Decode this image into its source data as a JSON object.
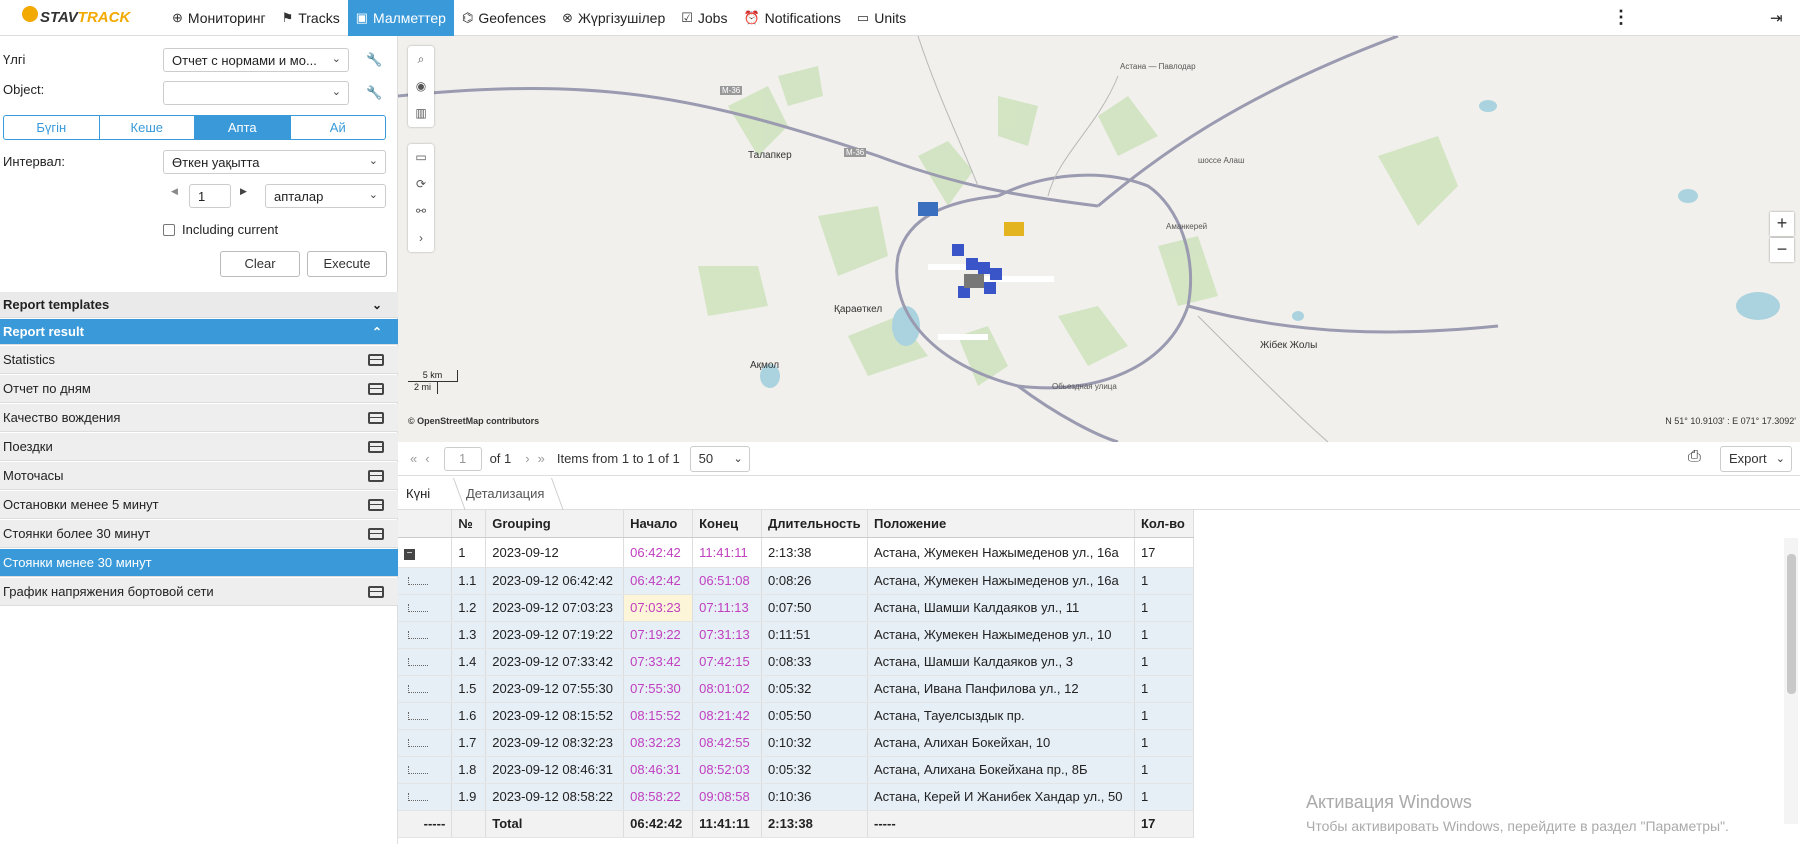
{
  "topbar": {
    "logo_left": "STAV",
    "logo_right": "TRACK",
    "nav": [
      {
        "label": "Мониторинг",
        "icon": "globe-icon"
      },
      {
        "label": "Tracks",
        "icon": "map-icon"
      },
      {
        "label": "Малметтер",
        "icon": "chart-icon",
        "active": true
      },
      {
        "label": "Geofences",
        "icon": "route-icon"
      },
      {
        "label": "Жүргізушілер",
        "icon": "steering-wheel-icon"
      },
      {
        "label": "Jobs",
        "icon": "clipboard-icon"
      },
      {
        "label": "Notifications",
        "icon": "alarm-icon"
      },
      {
        "label": "Units",
        "icon": "bus-icon"
      }
    ]
  },
  "form": {
    "template_label": "Үлгі",
    "template_value": "Отчет с нормами и мо...",
    "object_label": "Object:",
    "object_value": "",
    "periods": [
      "Бүгін",
      "Кеше",
      "Апта",
      "Ай"
    ],
    "active_period": "Апта",
    "interval_label": "Интервал:",
    "interval_value": "Өткен уақытта",
    "count_value": "1",
    "unit_value": "апталар",
    "including_current": "Including current",
    "clear": "Clear",
    "execute": "Execute"
  },
  "sections": {
    "templates": "Report templates",
    "result": "Report result"
  },
  "result_items": [
    "Statistics",
    "Отчет по дням",
    "Качество вождения",
    "Поездки",
    "Моточасы",
    "Остановки менее 5 минут",
    "Стоянки более 30 минут",
    "Стоянки менее 30 минут",
    "График напряжения бортовой сети"
  ],
  "selected_result": "Стоянки менее 30 минут",
  "map": {
    "labels": [
      "Талапкер",
      "Қараөткел",
      "Ақмол",
      "Жібек Жолы",
      "M-36",
      "M-36",
      "Обьездная улица",
      "Астана — Павлодар",
      "шоссе Алаш",
      "Аманкерей"
    ],
    "scale_km": "5 km",
    "scale_mi": "2 mi",
    "attribution": "© OpenStreetMap contributors",
    "coords": "N 51° 10.9103' : E 071° 17.3092'"
  },
  "pager": {
    "page": "1",
    "of": "of 1",
    "items": "Items from 1 to 1 of 1",
    "page_size": "50",
    "export": "Export"
  },
  "tabs": [
    "Күні",
    "Детализация"
  ],
  "table": {
    "headers": [
      "№",
      "Grouping",
      "Начало",
      "Конец",
      "Длительность",
      "Положение",
      "Кол-во"
    ],
    "group": {
      "num": "1",
      "grouping": "2023-09-12",
      "start": "06:42:42",
      "end": "11:41:11",
      "dur": "2:13:38",
      "place": "Астана, Жумекен Нажымеденов ул., 16а",
      "count": "17"
    },
    "rows": [
      {
        "num": "1.1",
        "grouping": "2023-09-12 06:42:42",
        "start": "06:42:42",
        "end": "06:51:08",
        "dur": "0:08:26",
        "place": "Астана, Жумекен Нажымеденов ул., 16а",
        "count": "1"
      },
      {
        "num": "1.2",
        "grouping": "2023-09-12 07:03:23",
        "start": "07:03:23",
        "end": "07:11:13",
        "dur": "0:07:50",
        "place": "Астана, Шамши Калдаяков ул., 11",
        "count": "1"
      },
      {
        "num": "1.3",
        "grouping": "2023-09-12 07:19:22",
        "start": "07:19:22",
        "end": "07:31:13",
        "dur": "0:11:51",
        "place": "Астана, Жумекен Нажымеденов ул., 10",
        "count": "1"
      },
      {
        "num": "1.4",
        "grouping": "2023-09-12 07:33:42",
        "start": "07:33:42",
        "end": "07:42:15",
        "dur": "0:08:33",
        "place": "Астана, Шамши Калдаяков ул., 3",
        "count": "1"
      },
      {
        "num": "1.5",
        "grouping": "2023-09-12 07:55:30",
        "start": "07:55:30",
        "end": "08:01:02",
        "dur": "0:05:32",
        "place": "Астана, Ивана Панфилова ул., 12",
        "count": "1"
      },
      {
        "num": "1.6",
        "grouping": "2023-09-12 08:15:52",
        "start": "08:15:52",
        "end": "08:21:42",
        "dur": "0:05:50",
        "place": "Астана, Тауелсыздык пр.",
        "count": "1"
      },
      {
        "num": "1.7",
        "grouping": "2023-09-12 08:32:23",
        "start": "08:32:23",
        "end": "08:42:55",
        "dur": "0:10:32",
        "place": "Астана, Алихан Бокейхан, 10",
        "count": "1"
      },
      {
        "num": "1.8",
        "grouping": "2023-09-12 08:46:31",
        "start": "08:46:31",
        "end": "08:52:03",
        "dur": "0:05:32",
        "place": "Астана, Алихана Бокейхана пр., 8Б",
        "count": "1"
      },
      {
        "num": "1.9",
        "grouping": "2023-09-12 08:58:22",
        "start": "08:58:22",
        "end": "09:08:58",
        "dur": "0:10:36",
        "place": "Астана, Керей И Жанибек Хандар ул., 50",
        "count": "1"
      }
    ],
    "total": {
      "num": "-----",
      "grouping": "Total",
      "start": "06:42:42",
      "end": "11:41:11",
      "dur": "2:13:38",
      "place": "-----",
      "count": "17"
    }
  },
  "watermark": {
    "line1": "Активация Windows",
    "line2": "Чтобы активировать Windows, перейдите в раздел \"Параметры\"."
  }
}
